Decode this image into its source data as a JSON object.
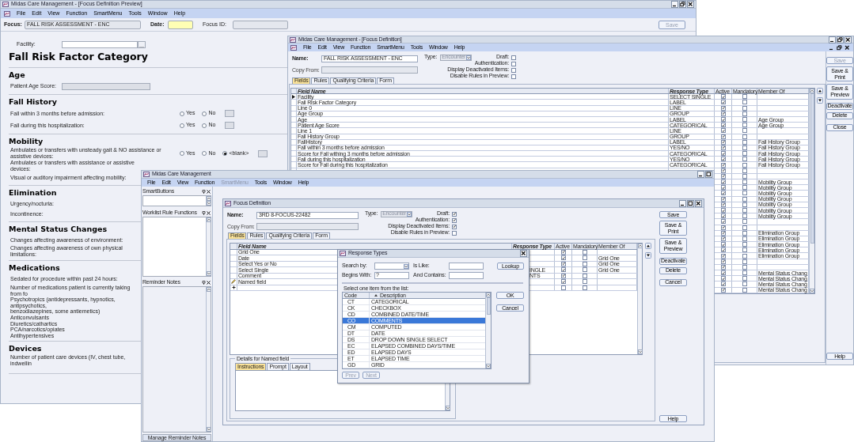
{
  "preview_window": {
    "title": "Midas Care Management - [Focus Definition Preview]",
    "menu": [
      {
        "label": "File",
        "disabled": false
      },
      {
        "label": "Edit",
        "disabled": false
      },
      {
        "label": "View",
        "disabled": false
      },
      {
        "label": "Function",
        "disabled": false
      },
      {
        "label": "SmartMenu",
        "disabled": false
      },
      {
        "label": "Tools",
        "disabled": false
      },
      {
        "label": "Window",
        "disabled": false
      },
      {
        "label": "Help",
        "disabled": false
      }
    ],
    "focus_label": "Focus:",
    "focus_value": "FALL RISK ASSESSMENT - ENC",
    "date_label": "Date:",
    "focus_id_label": "Focus ID:",
    "save_button": {
      "label": "Save",
      "disabled": true
    },
    "facility_label": "Facility:",
    "facility_button": "...",
    "heading": "Fall Risk Factor Category",
    "sections": [
      {
        "title": "Age",
        "items": [
          {
            "kind": "field",
            "label": "Patient Age Score:"
          }
        ]
      },
      {
        "title": "Fall History",
        "items": [
          {
            "kind": "radio",
            "label": "Fall within 3 months before admission:",
            "options": [
              {
                "label": "Yes",
                "selected": false
              },
              {
                "label": "No",
                "selected": false
              }
            ]
          },
          {
            "kind": "radio",
            "label": "Fall during this hospitalization:",
            "options": [
              {
                "label": "Yes",
                "selected": false
              },
              {
                "label": "No",
                "selected": false
              }
            ]
          }
        ]
      },
      {
        "title": "Mobility",
        "items": [
          {
            "kind": "radio",
            "label": "Ambulates or transfers with unsteady gait & NO assistance or assistive devices:",
            "options": [
              {
                "label": "Yes",
                "selected": false
              },
              {
                "label": "No",
                "selected": false
              },
              {
                "label": "<blank>",
                "selected": true
              }
            ]
          },
          {
            "kind": "label",
            "label": "Ambulates or transfers with assistance or assistive devices:"
          },
          {
            "kind": "label",
            "label": "Visual or auditory impairment affecting mobility:"
          }
        ]
      },
      {
        "title": "Elimination",
        "items": [
          {
            "kind": "label",
            "label": "Urgency/nocturia:"
          },
          {
            "kind": "label",
            "label": "Incontinence:"
          }
        ]
      },
      {
        "title": "Mental Status Changes",
        "items": [
          {
            "kind": "label",
            "label": "Changes affecting awareness of environment:"
          },
          {
            "kind": "label",
            "label": "Changes affecting awareness of own physical limitations:"
          }
        ]
      },
      {
        "title": "Medications",
        "items": [
          {
            "kind": "label",
            "label": "Sedated for procedure within past 24 hours:"
          },
          {
            "kind": "lines",
            "lines": [
              "Number of medications patient is currently taking from fo",
              "Psychotropics (antidepressants, hypnotics, antipsychotics,",
              "benzodiazepines, some antiemetics)",
              "Anticonvulsants",
              "Diuretics/cathartics",
              "PCA/narcotics/opiates",
              "Antihypertensives"
            ]
          }
        ]
      },
      {
        "title": "Devices",
        "items": [
          {
            "kind": "label",
            "label": "Number of patient care devices (IV, chest tube, indwellin"
          }
        ]
      }
    ]
  },
  "definition_window": {
    "title": "Midas Care Management - [Focus Definition]",
    "menu": [
      {
        "label": "File",
        "disabled": false
      },
      {
        "label": "Edit",
        "disabled": false
      },
      {
        "label": "View",
        "disabled": false
      },
      {
        "label": "Function",
        "disabled": false
      },
      {
        "label": "SmartMenu",
        "disabled": false
      },
      {
        "label": "Tools",
        "disabled": false
      },
      {
        "label": "Window",
        "disabled": false
      },
      {
        "label": "Help",
        "disabled": false
      }
    ],
    "name_label": "Name:",
    "name_value": "FALL RISK ASSESSMENT - ENC",
    "type_label": "Type:",
    "type_value": "Encounter",
    "copy_from_label": "Copy From:",
    "options": [
      {
        "label": "Draft:",
        "checked": false
      },
      {
        "label": "Authentication:",
        "checked": false
      },
      {
        "label": "Display Deactivated Items:",
        "checked": false
      },
      {
        "label": "Disable Rules in Preview:",
        "checked": false
      }
    ],
    "tabs": [
      {
        "label": "Fields",
        "selected": true
      },
      {
        "label": "Rules",
        "selected": false
      },
      {
        "label": "Qualifying Criteria",
        "selected": false
      },
      {
        "label": "Form",
        "selected": false
      }
    ],
    "columns": [
      "Field Name",
      "Response Type",
      "Active",
      "Mandatory",
      "Member Of"
    ],
    "rows": [
      {
        "current": true,
        "field_name": "Facility",
        "response_type": "SELECT SINGLE",
        "active": true,
        "mandatory": false
      },
      {
        "current": false,
        "field_name": "Fall Risk Factor Category",
        "response_type": "LABEL",
        "active": true,
        "mandatory": false
      },
      {
        "current": false,
        "field_name": "Line 0",
        "response_type": "LINE",
        "active": true,
        "mandatory": false
      },
      {
        "current": false,
        "field_name": "Age Group",
        "response_type": "GROUP",
        "active": true,
        "mandatory": false
      },
      {
        "current": false,
        "field_name": "Age",
        "response_type": "LABEL",
        "active": true,
        "mandatory": false,
        "member_of": "Age Group"
      },
      {
        "current": false,
        "field_name": "Patient Age Score",
        "response_type": "CATEGORICAL",
        "active": true,
        "mandatory": false,
        "member_of": "Age Group"
      },
      {
        "current": false,
        "field_name": "Line 1",
        "response_type": "LINE",
        "active": true,
        "mandatory": false
      },
      {
        "current": false,
        "field_name": "Fall History Group",
        "response_type": "GROUP",
        "active": true,
        "mandatory": false
      },
      {
        "current": false,
        "field_name": "FallHistory",
        "response_type": "LABEL",
        "active": true,
        "mandatory": false,
        "member_of": "Fall History Group"
      },
      {
        "current": false,
        "field_name": "Fall within 3 months before admission",
        "response_type": "YES/NO",
        "active": true,
        "mandatory": false,
        "member_of": "Fall History Group"
      },
      {
        "current": false,
        "field_name": "Score for Fall withing 3 months before admission",
        "response_type": "CATEGORICAL",
        "active": true,
        "mandatory": false,
        "member_of": "Fall History Group"
      },
      {
        "current": false,
        "field_name": "Fall during this hospitalization",
        "response_type": "YES/NO",
        "active": true,
        "mandatory": false,
        "member_of": "Fall History Group"
      },
      {
        "current": false,
        "field_name": "Score for Fall during this hospitalization",
        "response_type": "CATEGORICAL",
        "active": true,
        "mandatory": false,
        "member_of": "Fall History Group"
      },
      {
        "current": false,
        "active": true,
        "mandatory": false
      },
      {
        "current": false,
        "active": true,
        "mandatory": false
      },
      {
        "current": false,
        "active": true,
        "mandatory": false,
        "member_of": "Mobility Group"
      },
      {
        "current": false,
        "active": true,
        "mandatory": false,
        "member_of": "Mobility Group"
      },
      {
        "current": false,
        "active": true,
        "mandatory": false,
        "member_of": "Mobility Group"
      },
      {
        "current": false,
        "active": true,
        "mandatory": false,
        "member_of": "Mobility Group"
      },
      {
        "current": false,
        "active": true,
        "mandatory": false,
        "member_of": "Mobility Group"
      },
      {
        "current": false,
        "active": true,
        "mandatory": false,
        "member_of": "Mobility Group"
      },
      {
        "current": false,
        "active": true,
        "mandatory": false,
        "member_of": "Mobility Group"
      },
      {
        "current": false,
        "active": true,
        "mandatory": false
      },
      {
        "current": false,
        "active": true,
        "mandatory": false
      },
      {
        "current": false,
        "active": true,
        "mandatory": false,
        "member_of": "Elimination Group"
      },
      {
        "current": false,
        "active": true,
        "mandatory": false,
        "member_of": "Elimination Group"
      },
      {
        "current": false,
        "active": true,
        "mandatory": false,
        "member_of": "Elimination Group"
      },
      {
        "current": false,
        "active": true,
        "mandatory": false,
        "member_of": "Elimination Group"
      },
      {
        "current": false,
        "active": true,
        "mandatory": false,
        "member_of": "Elimination Group"
      },
      {
        "current": false,
        "active": true,
        "mandatory": false
      },
      {
        "current": false,
        "active": true,
        "mandatory": false
      },
      {
        "current": false,
        "active": true,
        "mandatory": false,
        "member_of": "Mental Status Chang"
      },
      {
        "current": false,
        "active": true,
        "mandatory": false,
        "member_of": "Mental Status Chang"
      },
      {
        "current": false,
        "active": true,
        "mandatory": false,
        "member_of": "Mental Status Chang"
      },
      {
        "current": false,
        "active": true,
        "mandatory": false,
        "member_of": "Mental Status Chang"
      }
    ],
    "buttons": [
      {
        "label": "Save",
        "disabled": true
      },
      {
        "label": "Save & Print",
        "disabled": false
      },
      {
        "label": "Save & Preview",
        "disabled": false
      },
      {
        "label": "Deactivate",
        "disabled": false
      },
      {
        "label": "Delete",
        "disabled": false
      },
      {
        "label": "Close",
        "disabled": false
      }
    ],
    "help_button": "Help"
  },
  "main_window": {
    "title": "Midas Care Management",
    "menu": [
      {
        "label": "File",
        "disabled": false
      },
      {
        "label": "Edit",
        "disabled": false
      },
      {
        "label": "View",
        "disabled": false
      },
      {
        "label": "Function",
        "disabled": false
      },
      {
        "label": "SmartMenu",
        "disabled": true
      },
      {
        "label": "Tools",
        "disabled": false
      },
      {
        "label": "Window",
        "disabled": false
      },
      {
        "label": "Help",
        "disabled": false
      }
    ],
    "panels": [
      {
        "title": "SmartButtons"
      },
      {
        "title": "Worklist Rule Functions"
      },
      {
        "title": "Reminder Notes"
      }
    ],
    "manage_notes_button": "Manage Reminder Notes",
    "focus_definition": {
      "title": "Focus Definition",
      "name_label": "Name:",
      "name_value": "3RD 8-FOCUS-22482",
      "type_label": "Type:",
      "type_value": "Encounter",
      "copy_from_label": "Copy From:",
      "options": [
        {
          "label": "Draft:",
          "checked": true
        },
        {
          "label": "Authentication:",
          "checked": true
        },
        {
          "label": "Display Deactivated Items:",
          "checked": true
        },
        {
          "label": "Disable Rules in Preview:",
          "checked": false
        }
      ],
      "tabs": [
        {
          "label": "Fields",
          "selected": true
        },
        {
          "label": "Rules",
          "selected": false
        },
        {
          "label": "Qualifying Criteria",
          "selected": false
        },
        {
          "label": "Form",
          "selected": false
        }
      ],
      "columns": [
        "Field Name",
        "Response Type",
        "Active",
        "Mandatory",
        "Member Of"
      ],
      "rows": [
        {
          "kind": "field",
          "editing": false,
          "field_name": "Grid One",
          "active": true,
          "mandatory": false
        },
        {
          "kind": "field",
          "editing": false,
          "field_name": "Date",
          "active": true,
          "mandatory": false,
          "member_of": "Grid One"
        },
        {
          "kind": "field",
          "editing": false,
          "field_name": "Select Yes or No",
          "active": true,
          "mandatory": false,
          "member_of": "Grid One"
        },
        {
          "kind": "field",
          "editing": false,
          "field_name": "Select Single",
          "response_type": "INGLE",
          "active": true,
          "mandatory": false,
          "member_of": "Grid One"
        },
        {
          "kind": "field",
          "editing": false,
          "field_name": "Comment",
          "response_type": "NTS",
          "active": true,
          "mandatory": false
        },
        {
          "kind": "field",
          "editing": true,
          "field_name": "Named field",
          "active": true,
          "mandatory": false
        },
        {
          "kind": "new",
          "editing": false,
          "active": false,
          "mandatory": false
        }
      ],
      "buttons": [
        {
          "label": "Save",
          "disabled": false
        },
        {
          "label": "Save & Print",
          "disabled": false
        },
        {
          "label": "Save & Preview",
          "disabled": false
        },
        {
          "label": "Deactivate",
          "disabled": false
        },
        {
          "label": "Delete",
          "disabled": false
        },
        {
          "label": "Cancel",
          "disabled": false
        }
      ],
      "help_button": "Help",
      "details": {
        "title": "Details for Named field",
        "tabs": [
          {
            "label": "Instructions",
            "selected": true
          },
          {
            "label": "Prompt",
            "selected": false
          },
          {
            "label": "Layout",
            "selected": false
          }
        ]
      }
    }
  },
  "response_types_dialog": {
    "title": "Response Types",
    "search_by_label": "Search by:",
    "is_like_label": "Is Like:",
    "lookup_button": "Lookup",
    "begins_with_label": "Begins With:",
    "begins_with_value": "?",
    "and_contains_label": "And Contains:",
    "list_label": "Select one item from the list:",
    "columns": [
      "Code",
      "Description"
    ],
    "items": [
      {
        "code": "CT",
        "description": "CATEGORICAL",
        "selected": false
      },
      {
        "code": "CK",
        "description": "CHECKBOX",
        "selected": false
      },
      {
        "code": "CD",
        "description": "COMBINED DATE/TIME",
        "selected": false
      },
      {
        "code": "CO",
        "description": "COMMENTS",
        "selected": true
      },
      {
        "code": "CM",
        "description": "COMPUTED",
        "selected": false
      },
      {
        "code": "DT",
        "description": "DATE",
        "selected": false
      },
      {
        "code": "DS",
        "description": "DROP DOWN SINGLE SELECT",
        "selected": false
      },
      {
        "code": "EC",
        "description": "ELAPSED COMBINED DAYS/TIME",
        "selected": false
      },
      {
        "code": "ED",
        "description": "ELAPSED DAYS",
        "selected": false
      },
      {
        "code": "ET",
        "description": "ELAPSED TIME",
        "selected": false
      },
      {
        "code": "GD",
        "description": "GRID",
        "selected": false
      }
    ],
    "ok_button": "OK",
    "cancel_button": "Cancel",
    "prev_button": {
      "label": "Prev",
      "disabled": true
    },
    "next_button": {
      "label": "Next",
      "disabled": true
    }
  }
}
